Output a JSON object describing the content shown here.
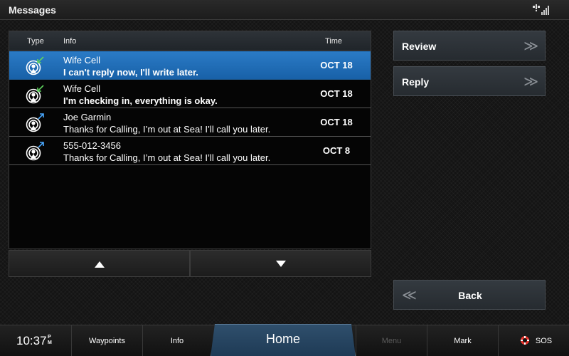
{
  "window": {
    "title": "Messages"
  },
  "table": {
    "headers": {
      "type": "Type",
      "info": "Info",
      "time": "Time"
    },
    "rows": [
      {
        "sender": "Wife Cell",
        "message": "I can't reply now, I'll write later.",
        "time": "OCT 18",
        "direction": "incoming",
        "selected": true,
        "bold": true
      },
      {
        "sender": "Wife Cell",
        "message": "I'm checking in, everything is okay.",
        "time": "OCT 18",
        "direction": "incoming",
        "selected": false,
        "bold": true
      },
      {
        "sender": "Joe Garmin",
        "message": "Thanks for Calling, I’m out at Sea!  I’ll call you later.",
        "time": "OCT 18",
        "direction": "outgoing",
        "selected": false,
        "bold": false
      },
      {
        "sender": "555-012-3456",
        "message": "Thanks for Calling, I’m out at Sea!  I’ll call you later.",
        "time": "OCT 8",
        "direction": "outgoing",
        "selected": false,
        "bold": false
      }
    ]
  },
  "actions": {
    "review": "Review",
    "reply": "Reply",
    "back": "Back",
    "chevron_right": "≫",
    "chevron_left": "≪"
  },
  "bottom_bar": {
    "clock_time": "10:37",
    "clock_ampm_top": "P",
    "clock_ampm_bottom": "M",
    "waypoints": "Waypoints",
    "info": "Info",
    "home": "Home",
    "menu": "Menu",
    "mark": "Mark",
    "sos": "SOS"
  },
  "colors": {
    "selected_row": "#1f6fb8",
    "incoming_arrow": "#5fd35f",
    "outgoing_arrow": "#4aa8ff",
    "sos_red": "#e8342c"
  },
  "icons": {
    "satellite": "satellite-signal-icon",
    "incoming": "incoming-message-icon",
    "outgoing": "outgoing-message-icon",
    "scroll_up": "triangle-up-icon",
    "scroll_down": "triangle-down-icon",
    "sos": "lifebuoy-icon"
  }
}
